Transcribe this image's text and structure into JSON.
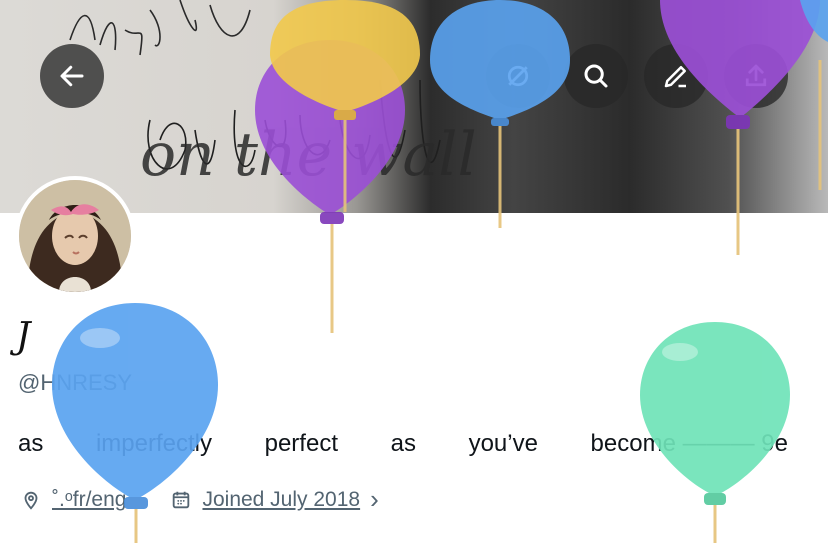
{
  "header": {
    "banner_text": "on the wall",
    "buttons": {
      "back_icon": "arrow-left-icon",
      "search_icon": "search-icon",
      "edit_icon": "edit-icon",
      "share_icon": "share-icon"
    }
  },
  "profile": {
    "display_name": "J",
    "handle": "@HNRESY",
    "bio_words": [
      "as",
      "imperfectly",
      "perfect",
      "as",
      "you’ve",
      "become ——— 9e"
    ],
    "location": "˚.ᵒfr/eng",
    "joined": "Joined July 2018",
    "joined_chevron": "›"
  },
  "colors": {
    "balloon_yellow": "#f2c94c",
    "balloon_purple": "#9b4fd6",
    "balloon_blue": "#5aa3f0",
    "balloon_green": "#6fe3b8",
    "text_secondary": "#536471"
  }
}
